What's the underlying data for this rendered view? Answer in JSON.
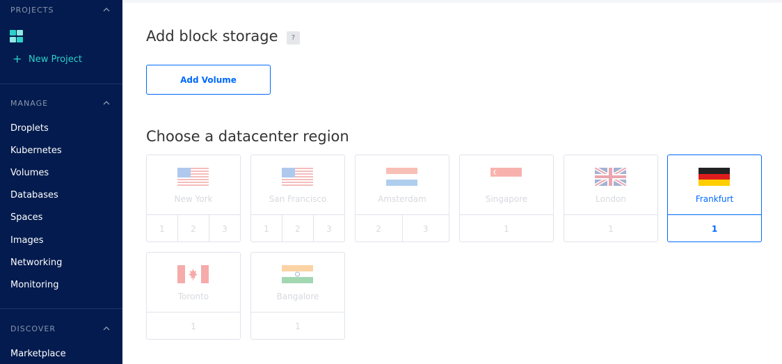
{
  "sidebar": {
    "projects_heading": "PROJECTS",
    "new_project_label": "New Project",
    "manage_heading": "MANAGE",
    "manage_items": [
      "Droplets",
      "Kubernetes",
      "Volumes",
      "Databases",
      "Spaces",
      "Images",
      "Networking",
      "Monitoring"
    ],
    "discover_heading": "DISCOVER",
    "discover_items": [
      "Marketplace"
    ]
  },
  "main": {
    "block_storage_title": "Add block storage",
    "help_label": "?",
    "add_volume_label": "Add Volume",
    "region_title": "Choose a datacenter region",
    "regions": [
      {
        "name": "New York",
        "options": [
          "1",
          "2",
          "3"
        ],
        "selected": false,
        "flag": "us-flag"
      },
      {
        "name": "San Francisco",
        "options": [
          "1",
          "2",
          "3"
        ],
        "selected": false,
        "flag": "us-flag"
      },
      {
        "name": "Amsterdam",
        "options": [
          "2",
          "3"
        ],
        "selected": false,
        "flag": "nl-flag"
      },
      {
        "name": "Singapore",
        "options": [
          "1"
        ],
        "selected": false,
        "flag": "sg-flag"
      },
      {
        "name": "London",
        "options": [
          "1"
        ],
        "selected": false,
        "flag": "uk-flag"
      },
      {
        "name": "Frankfurt",
        "options": [
          "1"
        ],
        "selected": true,
        "flag": "de-flag"
      },
      {
        "name": "Toronto",
        "options": [
          "1"
        ],
        "selected": false,
        "flag": "ca-flag"
      },
      {
        "name": "Bangalore",
        "options": [
          "1"
        ],
        "selected": false,
        "flag": "in-flag"
      }
    ]
  },
  "colors": {
    "sidebar_bg": "#031b4e",
    "accent": "#0069ff",
    "teal": "#2dd1c9"
  }
}
